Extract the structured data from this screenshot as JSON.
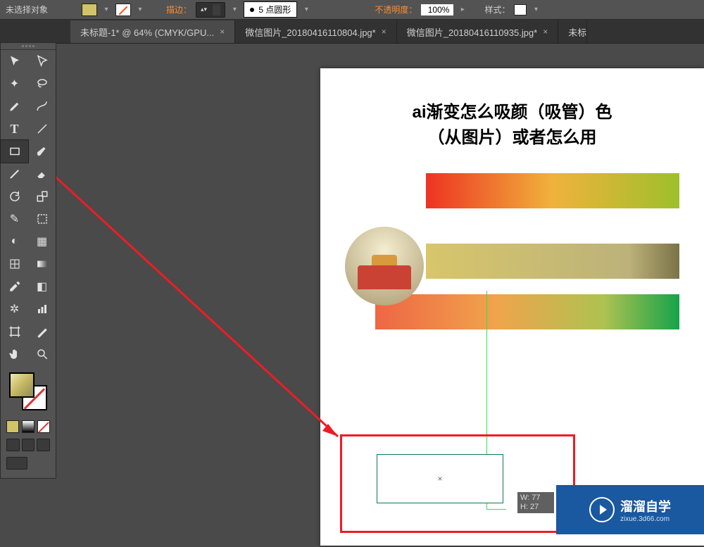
{
  "ctrlbar": {
    "no_selection": "未选择对象",
    "stroke_label": "描边：",
    "stroke_weight": "5 点圆形",
    "opacity_label": "不透明度：",
    "opacity_value": "100%",
    "style_label": "样式："
  },
  "tabs": [
    {
      "label": "未标题-1* @ 64% (CMYK/GPU...",
      "active": true
    },
    {
      "label": "微信图片_20180416110804.jpg*",
      "active": false
    },
    {
      "label": "微信图片_20180416110935.jpg*",
      "active": false
    },
    {
      "label": "未标",
      "active": false,
      "trunc": true
    }
  ],
  "canvas": {
    "title_line1": "ai渐变怎么吸颜（吸管）色",
    "title_line2": "（从图片）或者怎么用",
    "dim_w": "W: 77",
    "dim_h": "H: 27"
  },
  "watermark": {
    "brand": "溜溜自学",
    "url": "zixue.3d66.com"
  }
}
